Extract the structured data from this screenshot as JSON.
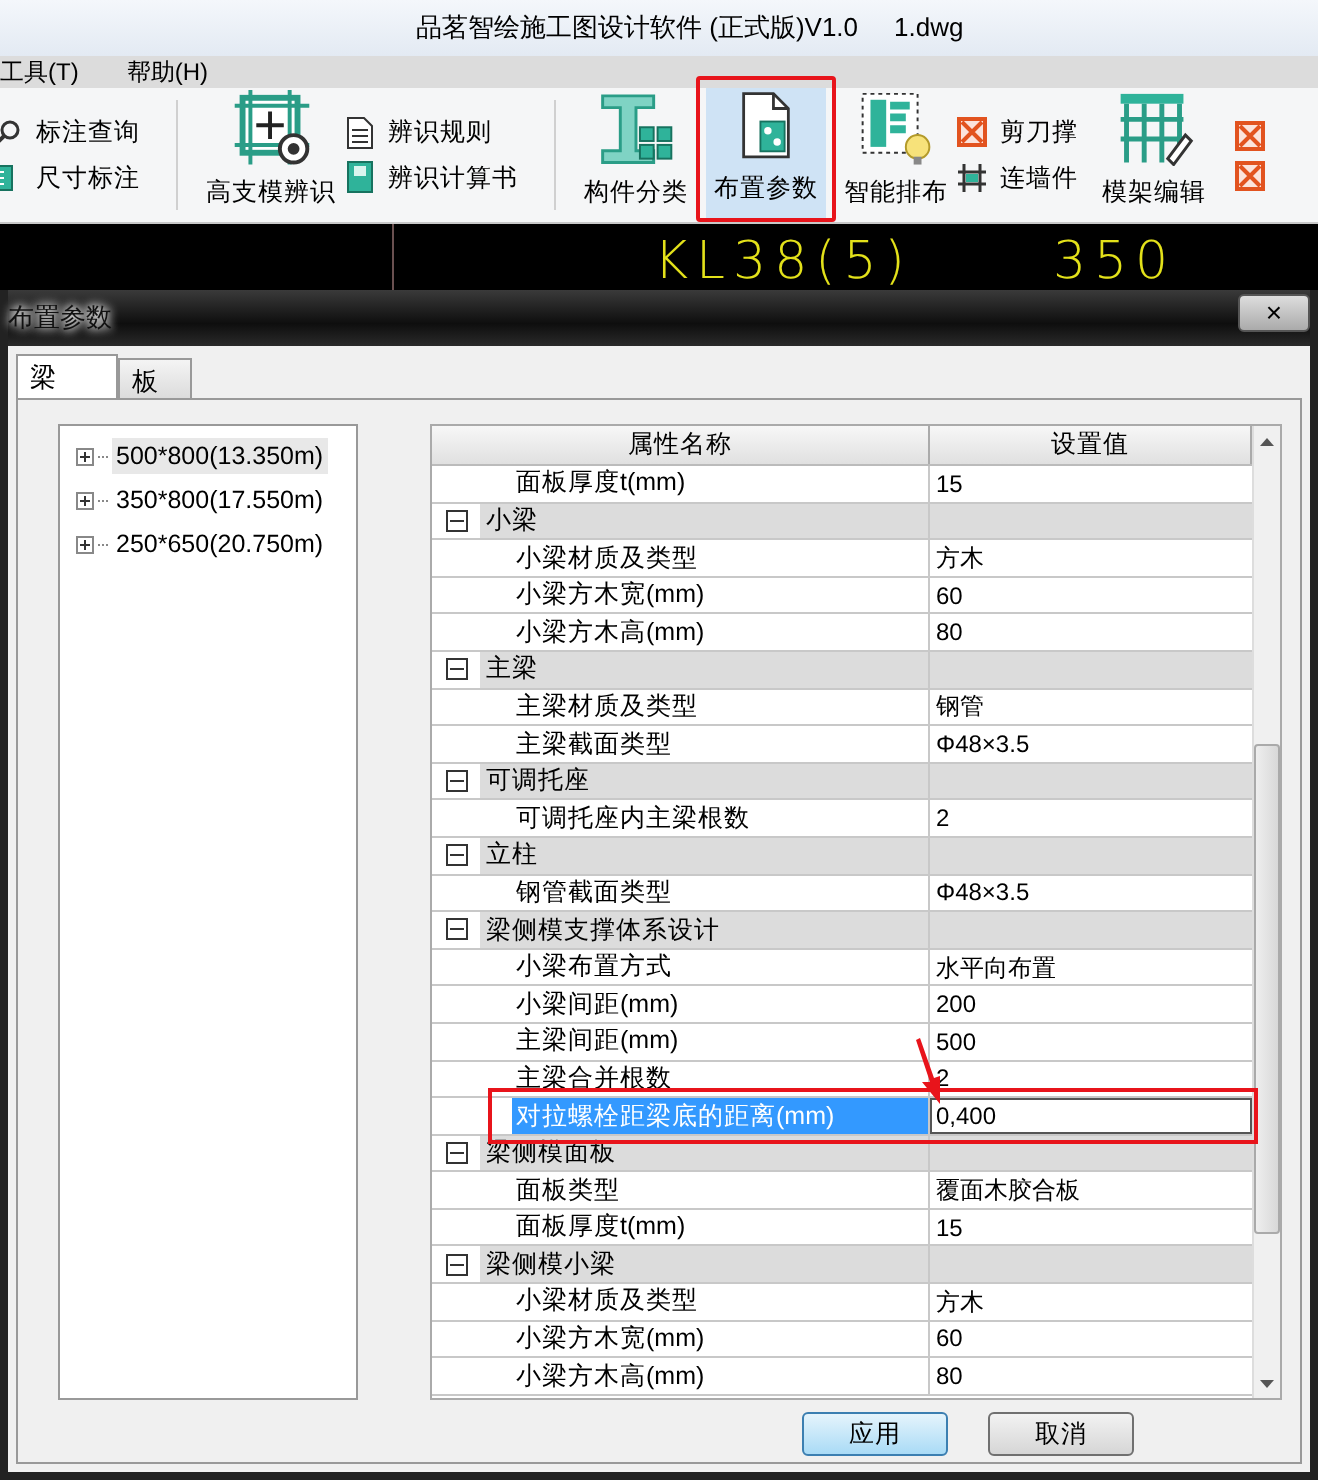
{
  "window": {
    "title": "品茗智绘施工图设计软件 (正式版)V1.0",
    "file": "1.dwg"
  },
  "menu": [
    "工具(T)",
    "帮助(H)"
  ],
  "toolbar": [
    {
      "kind": "stack",
      "items": [
        "标注查询",
        "尺寸标注"
      ]
    },
    {
      "kind": "separator"
    },
    {
      "kind": "large",
      "label": "高支模辨识",
      "selected": false,
      "annotated": false
    },
    {
      "kind": "stack",
      "items": [
        "辨识规则",
        "辨识计算书"
      ]
    },
    {
      "kind": "separator"
    },
    {
      "kind": "large",
      "label": "构件分类",
      "selected": false,
      "annotated": false
    },
    {
      "kind": "large",
      "label": "布置参数",
      "selected": true,
      "annotated": true
    },
    {
      "kind": "large",
      "label": "智能排布",
      "selected": false,
      "annotated": false
    },
    {
      "kind": "stack",
      "items": [
        "剪刀撑",
        "连墙件"
      ]
    },
    {
      "kind": "large",
      "label": "模架编辑",
      "selected": false,
      "annotated": false
    }
  ],
  "cad_text": [
    "KL38(5)",
    "350"
  ],
  "dialog": {
    "title": "布置参数",
    "close": "×",
    "tabs": [
      {
        "label": "梁",
        "selected": true
      },
      {
        "label": "板",
        "selected": false
      }
    ],
    "tree": [
      {
        "label": "500*800(13.350m)",
        "selected": true,
        "expanded": false
      },
      {
        "label": "350*800(17.550m)",
        "selected": false,
        "expanded": false
      },
      {
        "label": "250*650(20.750m)",
        "selected": false,
        "expanded": false
      }
    ],
    "grid": {
      "columns": [
        "属性名称",
        "设置值"
      ],
      "rows": [
        {
          "kind": "prop",
          "label": "面板厚度t(mm)",
          "value": "15",
          "selected": false
        },
        {
          "kind": "group",
          "label": "小梁",
          "expanded": true
        },
        {
          "kind": "prop",
          "label": "小梁材质及类型",
          "value": "方木",
          "selected": false
        },
        {
          "kind": "prop",
          "label": "小梁方木宽(mm)",
          "value": "60",
          "selected": false
        },
        {
          "kind": "prop",
          "label": "小梁方木高(mm)",
          "value": "80",
          "selected": false
        },
        {
          "kind": "group",
          "label": "主梁",
          "expanded": true
        },
        {
          "kind": "prop",
          "label": "主梁材质及类型",
          "value": "钢管",
          "selected": false
        },
        {
          "kind": "prop",
          "label": "主梁截面类型",
          "value": "Φ48×3.5",
          "selected": false
        },
        {
          "kind": "group",
          "label": "可调托座",
          "expanded": true
        },
        {
          "kind": "prop",
          "label": "可调托座内主梁根数",
          "value": "2",
          "selected": false
        },
        {
          "kind": "group",
          "label": "立柱",
          "expanded": true
        },
        {
          "kind": "prop",
          "label": "钢管截面类型",
          "value": "Φ48×3.5",
          "selected": false
        },
        {
          "kind": "group",
          "label": "梁侧模支撑体系设计",
          "expanded": true
        },
        {
          "kind": "prop",
          "label": "小梁布置方式",
          "value": "水平向布置",
          "selected": false
        },
        {
          "kind": "prop",
          "label": "小梁间距(mm)",
          "value": "200",
          "selected": false
        },
        {
          "kind": "prop",
          "label": "主梁间距(mm)",
          "value": "500",
          "selected": false
        },
        {
          "kind": "prop",
          "label": "主梁合并根数",
          "value": "2",
          "selected": false
        },
        {
          "kind": "prop",
          "label": "对拉螺栓距梁底的距离(mm)",
          "value": "0,400",
          "selected": true,
          "annotated": true
        },
        {
          "kind": "group",
          "label": "梁侧模面板",
          "expanded": true
        },
        {
          "kind": "prop",
          "label": "面板类型",
          "value": "覆面木胶合板",
          "selected": false
        },
        {
          "kind": "prop",
          "label": "面板厚度t(mm)",
          "value": "15",
          "selected": false
        },
        {
          "kind": "group",
          "label": "梁侧模小梁",
          "expanded": true
        },
        {
          "kind": "prop",
          "label": "小梁材质及类型",
          "value": "方木",
          "selected": false
        },
        {
          "kind": "prop",
          "label": "小梁方木宽(mm)",
          "value": "60",
          "selected": false
        },
        {
          "kind": "prop",
          "label": "小梁方木高(mm)",
          "value": "80",
          "selected": false
        }
      ]
    },
    "buttons": [
      {
        "label": "应用",
        "focused": true
      },
      {
        "label": "取消",
        "focused": false
      }
    ]
  }
}
